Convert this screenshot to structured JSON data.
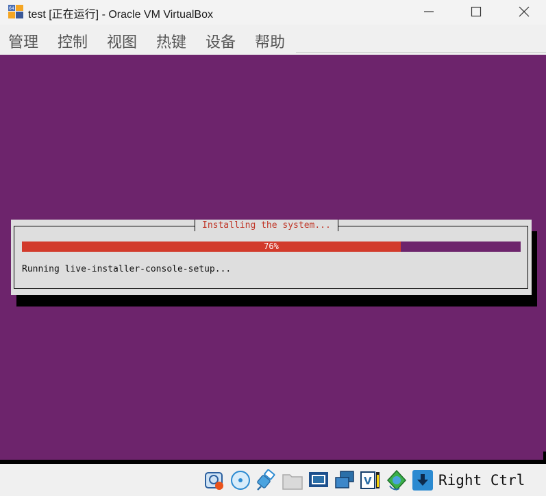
{
  "window": {
    "title": "test [正在运行] - Oracle VM VirtualBox"
  },
  "menu": {
    "items": [
      "管理",
      "控制",
      "视图",
      "热键",
      "设备",
      "帮助"
    ]
  },
  "installer": {
    "dialog_title": "Installing the system...",
    "progress": 0.76,
    "progress_label": "76%",
    "status": "Running live-installer-console-setup..."
  },
  "statusbar": {
    "icons": [
      "hard-disk-icon",
      "optical-drive-icon",
      "usb-icon",
      "shared-folders-icon",
      "display-icon",
      "network-icon",
      "video-capture-icon",
      "guest-additions-icon",
      "mouse-integration-icon"
    ],
    "host_key": "Right Ctrl"
  },
  "colors": {
    "guest_background": "#6d246c",
    "progress_fill": "#d23a2b",
    "dialog_background": "#dedede",
    "dialog_title_text": "#c0392b"
  }
}
